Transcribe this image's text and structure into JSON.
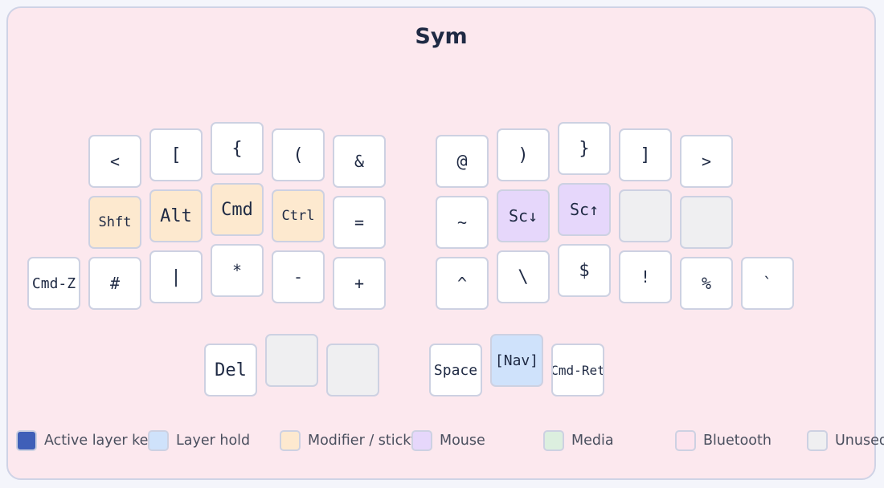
{
  "title": "Sym",
  "keys": {
    "l_r1_c0": "<",
    "l_r1_c1": "[",
    "l_r1_c2": "{",
    "l_r1_c3": "(",
    "l_r1_c4": "&",
    "r_r1_c0": "@",
    "r_r1_c1": ")",
    "r_r1_c2": "}",
    "r_r1_c3": "]",
    "r_r1_c4": ">",
    "l_r2_c0": "Shft",
    "l_r2_c1": "Alt",
    "l_r2_c2": "Cmd",
    "l_r2_c3": "Ctrl",
    "l_r2_c4": "=",
    "r_r2_c0": "~",
    "r_r2_c1": "Sc↓",
    "r_r2_c2": "Sc↑",
    "r_r2_c3": "",
    "r_r2_c4": "",
    "l_r3_outer": "Cmd-Z",
    "l_r3_c0": "#",
    "l_r3_c1": "|",
    "l_r3_c2": "*",
    "l_r3_c3": "-",
    "l_r3_c4": "+",
    "r_r3_c0": "^",
    "r_r3_c1": "\\",
    "r_r3_c2": "$",
    "r_r3_c3": "!",
    "r_r3_c4": "%",
    "r_r3_outer": "`",
    "l_th_0": "Del",
    "l_th_1": "",
    "l_th_2": "",
    "r_th_0": "Space",
    "r_th_1": "[Nav]",
    "r_th_2": "Cmd-Ret"
  },
  "legend": [
    {
      "label": "Active layer key",
      "color": "#3f5fb8"
    },
    {
      "label": "Layer hold",
      "color": "#cfe2fb"
    },
    {
      "label": "Modifier / sticky",
      "color": "#fde9cf"
    },
    {
      "label": "Mouse",
      "color": "#e6d7fb"
    },
    {
      "label": "Media",
      "color": "#dcefdf"
    },
    {
      "label": "Bluetooth",
      "color": "#fce4ee"
    },
    {
      "label": "Unused",
      "color": "#efeff1"
    }
  ]
}
